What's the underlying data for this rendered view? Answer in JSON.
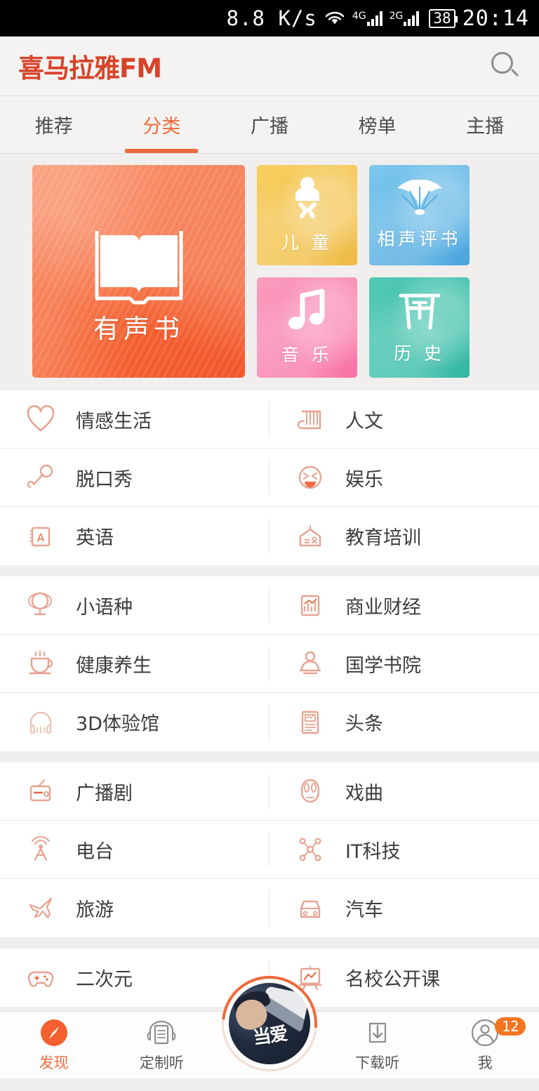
{
  "statusbar": {
    "net_speed": "8.8 K/s",
    "wifi_icon": "wifi-icon",
    "net_primary": "4G",
    "net_secondary": "2G",
    "battery_level": "38",
    "time": "20:14"
  },
  "header": {
    "logo": "喜马拉雅FM",
    "search_icon": "search-icon"
  },
  "tabs": [
    {
      "label": "推荐",
      "active": false
    },
    {
      "label": "分类",
      "active": true
    },
    {
      "label": "广播",
      "active": false
    },
    {
      "label": "榜单",
      "active": false
    },
    {
      "label": "主播",
      "active": false
    }
  ],
  "featured": {
    "main": {
      "label": "有声书",
      "icon": "open-book-icon",
      "color": "#f4612f"
    },
    "tiles": [
      {
        "label": "儿 童",
        "icon": "baby-icon",
        "color": "#f2c24b"
      },
      {
        "label": "相声评书",
        "icon": "folding-fan-icon",
        "color": "#55aee2"
      },
      {
        "label": "音 乐",
        "icon": "music-note-icon",
        "color": "#f97fae"
      },
      {
        "label": "历 史",
        "icon": "gate-archway-icon",
        "color": "#3cbfa9"
      }
    ]
  },
  "categories": [
    {
      "rows": [
        {
          "left": {
            "label": "情感生活",
            "icon": "heart-icon"
          },
          "right": {
            "label": "人文",
            "icon": "scroll-book-icon"
          }
        },
        {
          "left": {
            "label": "脱口秀",
            "icon": "microphone-icon"
          },
          "right": {
            "label": "娱乐",
            "icon": "laughing-face-icon"
          }
        },
        {
          "left": {
            "label": "英语",
            "icon": "letter-a-card-icon"
          },
          "right": {
            "label": "教育培训",
            "icon": "hanging-sign-icon"
          }
        }
      ]
    },
    {
      "rows": [
        {
          "left": {
            "label": "小语种",
            "icon": "globe-icon"
          },
          "right": {
            "label": "商业财经",
            "icon": "bar-chart-icon"
          }
        },
        {
          "left": {
            "label": "健康养生",
            "icon": "teacup-icon"
          },
          "right": {
            "label": "国学书院",
            "icon": "scholar-icon"
          }
        },
        {
          "left": {
            "label": "3D体验馆",
            "icon": "headphones-icon"
          },
          "right": {
            "label": "头条",
            "icon": "newspaper-icon"
          }
        }
      ]
    },
    {
      "rows": [
        {
          "left": {
            "label": "广播剧",
            "icon": "radio-icon"
          },
          "right": {
            "label": "戏曲",
            "icon": "opera-mask-icon"
          }
        },
        {
          "left": {
            "label": "电台",
            "icon": "broadcast-tower-icon"
          },
          "right": {
            "label": "IT科技",
            "icon": "molecule-icon"
          }
        },
        {
          "left": {
            "label": "旅游",
            "icon": "airplane-icon"
          },
          "right": {
            "label": "汽车",
            "icon": "car-icon"
          }
        }
      ]
    },
    {
      "rows": [
        {
          "left": {
            "label": "二次元",
            "icon": "gamepad-icon"
          },
          "right": {
            "label": "名校公开课",
            "icon": "presentation-board-icon"
          }
        }
      ]
    }
  ],
  "bottomnav": {
    "items": [
      {
        "label": "发现",
        "icon": "compass-icon",
        "active": true,
        "badge": ""
      },
      {
        "label": "定制听",
        "icon": "headphone-document-icon",
        "active": false,
        "badge": ""
      },
      {
        "label": "下载听",
        "icon": "download-icon",
        "active": false,
        "badge": ""
      },
      {
        "label": "我",
        "icon": "person-icon",
        "active": false,
        "badge": "12"
      }
    ],
    "player": {
      "title": "当爱",
      "icon": "player-avatar"
    }
  },
  "colors": {
    "accent": "#ef6a3d",
    "logo": "#d8432a",
    "icon_outline": "#e8a290",
    "badge": "#f47521"
  }
}
